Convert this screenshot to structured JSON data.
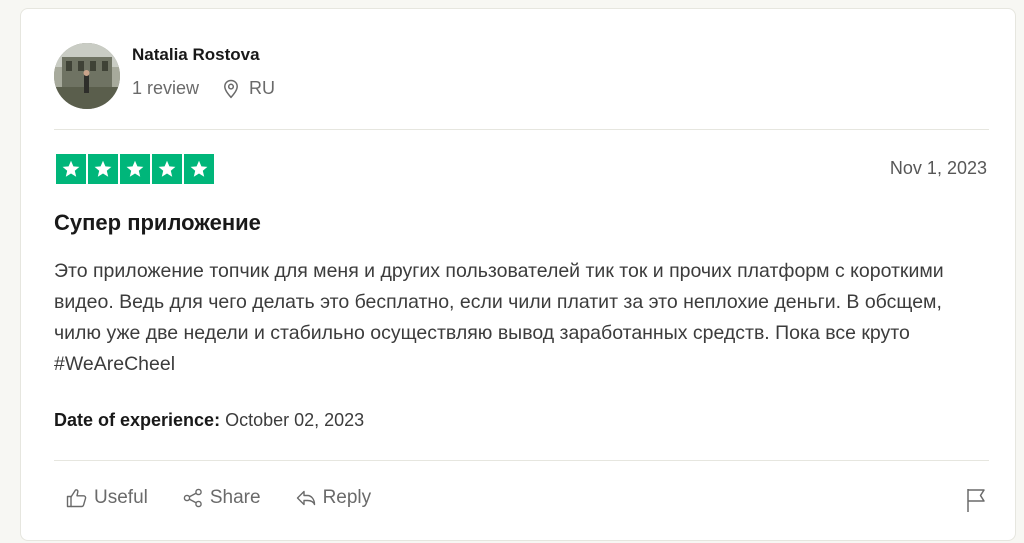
{
  "reviewer": {
    "name": "Natalia Rostova",
    "reviews": "1 review",
    "country": "RU",
    "avatar_icon": "avatar-photo"
  },
  "review": {
    "rating": 5,
    "rating_max": 5,
    "star_color": "#00b67a",
    "date": "Nov 1, 2023",
    "title": "Супер приложение",
    "body": "Это приложение топчик для меня и других пользователей тик ток и прочих платформ с короткими видео. Ведь для чего делать это бесплатно, если чили платит за это неплохие деньги. В обсщем, чилю уже две недели и стабильно осуществляю вывод заработанных средств. Пока все круто #WeAreCheel",
    "experience_label": "Date of experience:",
    "experience_date": "October 02, 2023"
  },
  "actions": {
    "useful": "Useful",
    "share": "Share",
    "reply": "Reply",
    "useful_icon": "thumbs-up-icon",
    "share_icon": "share-icon",
    "reply_icon": "reply-icon",
    "flag_icon": "flag-icon"
  }
}
